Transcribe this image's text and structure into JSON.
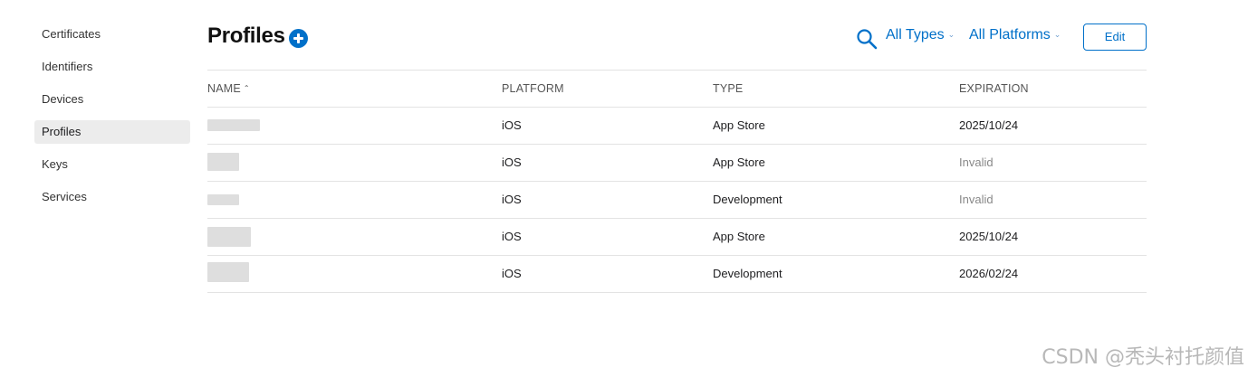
{
  "sidebar": {
    "items": [
      {
        "label": "Certificates"
      },
      {
        "label": "Identifiers"
      },
      {
        "label": "Devices"
      },
      {
        "label": "Profiles",
        "active": true
      },
      {
        "label": "Keys"
      },
      {
        "label": "Services"
      }
    ]
  },
  "header": {
    "title": "Profiles",
    "add_icon": "plus-circle-icon",
    "search_icon": "search-icon",
    "filter_types": "All Types",
    "filter_platforms": "All Platforms",
    "edit_label": "Edit",
    "accent_color": "#0070c9"
  },
  "table": {
    "columns": {
      "name": "NAME",
      "platform": "PLATFORM",
      "type": "TYPE",
      "expiration": "EXPIRATION"
    },
    "rows": [
      {
        "platform": "iOS",
        "type": "App Store",
        "expiration": "2025/10/24"
      },
      {
        "platform": "iOS",
        "type": "App Store",
        "expiration": "Invalid"
      },
      {
        "platform": "iOS",
        "type": "Development",
        "expiration": "Invalid"
      },
      {
        "platform": "iOS",
        "type": "App Store",
        "expiration": "2025/10/24"
      },
      {
        "platform": "iOS",
        "type": "Development",
        "expiration": "2026/02/24"
      }
    ]
  },
  "watermark": "CSDN @秃头衬托颜值"
}
